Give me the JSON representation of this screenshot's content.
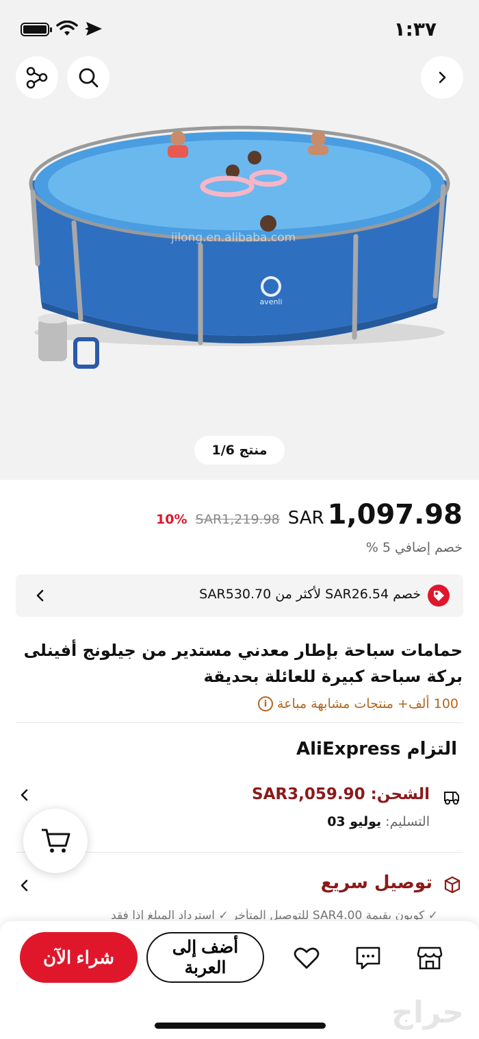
{
  "status": {
    "time": "١:٣٧",
    "battery_level": 0.85
  },
  "hero": {
    "counter": "منتج 1/6",
    "watermark": "jilong.en.alibaba.com",
    "brand_logo": "avenli"
  },
  "price": {
    "current": "1,097.98",
    "currency": "SAR",
    "old": "SAR1,219.98",
    "discount_pct": "10%",
    "extra_discount": "خصم إضافي 5 %"
  },
  "coupon": {
    "text": "خصم SAR26.54 لأكثر من SAR530.70"
  },
  "product": {
    "title": "حمامات سباحة بإطار معدني مستدير من جيلونج أفينلى بركة سباحة كبيرة للعائلة بحديقة",
    "similar": "100 ألف+ منتجات مشابهة مباعة"
  },
  "commitment": {
    "title": "التزام AliExpress"
  },
  "shipping": {
    "price": "الشحن: SAR3,059.90",
    "delivery_label": "التسليم:",
    "delivery_value": "يوليو 03"
  },
  "fast": {
    "title": "توصيل سريع",
    "subtitle": "✓ كوبون بقيمة SAR4.00 للتوصيل المتأخر ✓ استرداد المبلغ إذا فقد"
  },
  "bottom": {
    "buy_now": "شراء الآن",
    "add_to_cart": "أضف إلى العربة",
    "haraj_watermark": "حراج"
  },
  "colors": {
    "accent": "#e0172b",
    "maroon": "#8b1a1a",
    "pool_blue": "#2f6fc0"
  }
}
